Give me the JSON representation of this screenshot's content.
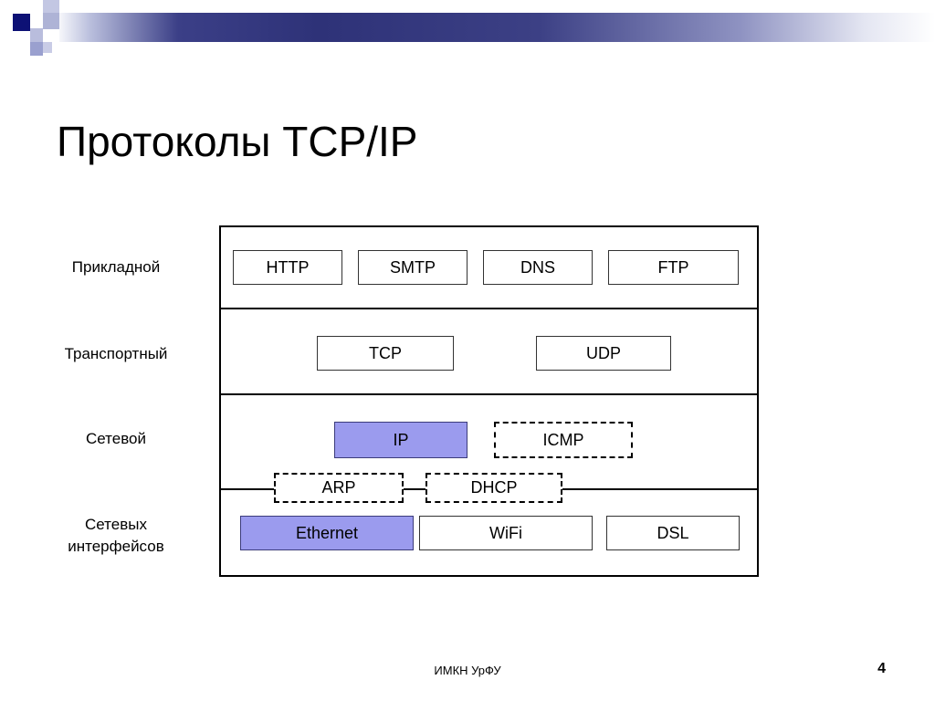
{
  "slide": {
    "title": "Протоколы TCP/IP",
    "footer_note": "ИМКН УрФУ",
    "page_number": "4"
  },
  "colors": {
    "highlight": "#9b9bee",
    "highlight_border": "#3b3b7a",
    "band_dark": "#2e3278",
    "band_square": "#0d1175",
    "box_border": "#333333",
    "frame": "#000000"
  },
  "diagram": {
    "kind": "tcp-ip-protocol-stack",
    "layers": [
      {
        "label": "Прикладной",
        "protocols": [
          {
            "name": "HTTP",
            "style": "solid"
          },
          {
            "name": "SMTP",
            "style": "solid"
          },
          {
            "name": "DNS",
            "style": "solid"
          },
          {
            "name": "FTP",
            "style": "solid"
          }
        ]
      },
      {
        "label": "Транспортный",
        "protocols": [
          {
            "name": "TCP",
            "style": "solid"
          },
          {
            "name": "UDP",
            "style": "solid"
          }
        ]
      },
      {
        "label": "Сетевой",
        "protocols": [
          {
            "name": "IP",
            "style": "highlighted"
          },
          {
            "name": "ICMP",
            "style": "dashed"
          }
        ]
      },
      {
        "label": "Сетевых интерфейсов",
        "label_lines": [
          "Сетевых",
          "интерфейсов"
        ],
        "protocols": [
          {
            "name": "Ethernet",
            "style": "highlighted"
          },
          {
            "name": "WiFi",
            "style": "solid"
          },
          {
            "name": "DSL",
            "style": "solid"
          }
        ]
      }
    ],
    "straddling_protocols": [
      {
        "name": "ARP",
        "style": "dashed",
        "between": [
          "Сетевой",
          "Сетевых интерфейсов"
        ]
      },
      {
        "name": "DHCP",
        "style": "dashed",
        "between": [
          "Сетевой",
          "Сетевых интерфейсов"
        ]
      }
    ]
  }
}
